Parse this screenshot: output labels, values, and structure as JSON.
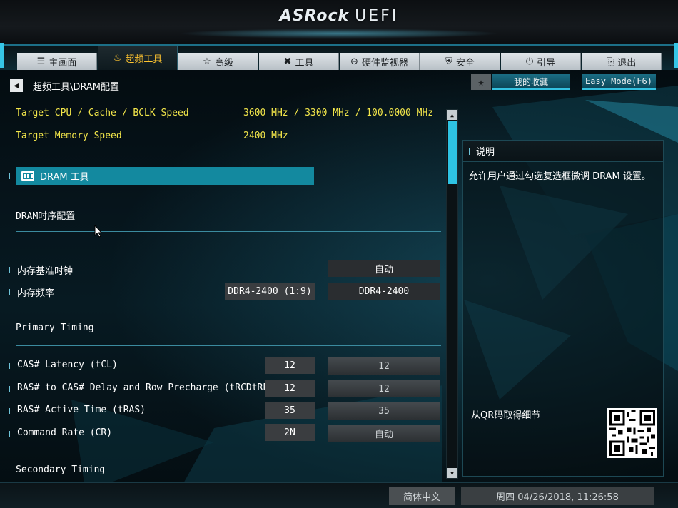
{
  "header": {
    "brand": "ASRock",
    "product": "UEFI"
  },
  "tabs": [
    {
      "label": "主画面",
      "icon": "list-icon",
      "glyph": "☰"
    },
    {
      "label": "超频工具",
      "icon": "flame-icon",
      "glyph": "♨"
    },
    {
      "label": "高级",
      "icon": "star-icon",
      "glyph": "☆"
    },
    {
      "label": "工具",
      "icon": "tools-icon",
      "glyph": "✖"
    },
    {
      "label": "硬件监视器",
      "icon": "monitor-icon",
      "glyph": "⊖"
    },
    {
      "label": "安全",
      "icon": "shield-icon",
      "glyph": "⛨"
    },
    {
      "label": "引导",
      "icon": "power-icon",
      "glyph": "⏻"
    },
    {
      "label": "退出",
      "icon": "exit-icon",
      "glyph": "⎘"
    }
  ],
  "active_tab": "超频工具",
  "breadcrumb": "超频工具\\DRAM配置",
  "target": {
    "cpu_label": "Target CPU / Cache / BCLK Speed",
    "cpu_value": "3600 MHz / 3300 MHz / 100.0000 MHz",
    "mem_label": "Target Memory Speed",
    "mem_value": "2400 MHz"
  },
  "dram_tool": "DRAM 工具",
  "section_timing_config": "DRAM时序配置",
  "mem_clock": {
    "label": "内存基准时钟",
    "option": "自动"
  },
  "mem_freq": {
    "label": "内存频率",
    "current": "DDR4-2400 (1:9)",
    "option": "DDR4-2400"
  },
  "primary_timing": "Primary Timing",
  "timings": [
    {
      "label": "CAS# Latency (tCL)",
      "current": "12",
      "option": "12"
    },
    {
      "label": "RAS# to CAS# Delay and Row Precharge (tRCDtRP)",
      "current": "12",
      "option": "12"
    },
    {
      "label": "RAS# Active Time (tRAS)",
      "current": "35",
      "option": "35"
    },
    {
      "label": "Command Rate (CR)",
      "current": "2N",
      "option": "自动"
    }
  ],
  "secondary_timing": "Secondary Timing",
  "right": {
    "favorites": "我的收藏",
    "easy_mode": "Easy Mode(F6)",
    "desc_title": "说明",
    "desc_text": "允许用户通过勾选复选框微调 DRAM 设置。",
    "qr_label": "从QR码取得细节"
  },
  "footer": {
    "language": "简体中文",
    "datetime": "周四 04/26/2018, 11:26:58"
  },
  "colors": {
    "accent": "#2ec3e3",
    "highlight": "#13899f",
    "target_text": "#f3e64a",
    "active_tab_text": "#ffc530"
  }
}
